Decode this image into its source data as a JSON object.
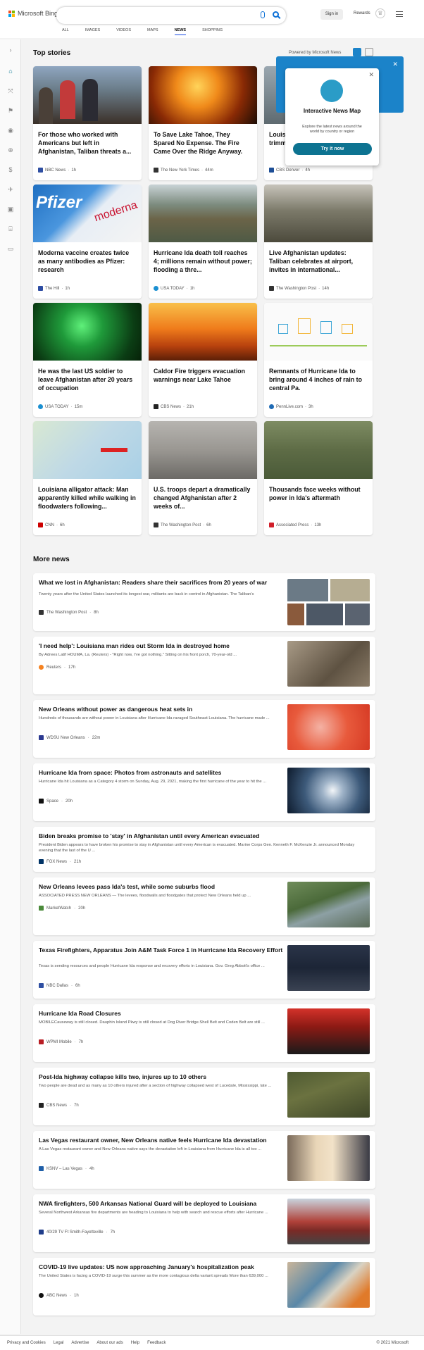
{
  "header": {
    "brand": "Microsoft Bing",
    "signin": "Sign in",
    "rewards": "Rewards",
    "tabs": [
      "ALL",
      "IMAGES",
      "VIDEOS",
      "MAPS",
      "NEWS",
      "SHOPPING"
    ],
    "active_tab": "NEWS"
  },
  "top_stories": {
    "heading": "Top stories",
    "powered_by": "Powered by Microsoft News",
    "cards": [
      {
        "title": "For those who worked with Americans but left in Afghanistan, Taliban threats a...",
        "source": "NBC News",
        "time": "1h",
        "source_color": "#2f4fa2"
      },
      {
        "title": "To Save Lake Tahoe, They Spared No Expense. The Fire Came Over the Ridge Anyway.",
        "source": "The New York Times",
        "time": "44m",
        "source_color": "#333333"
      },
      {
        "title": "Louisiana power grid, tree trimming, Grate... Red C...",
        "source": "CBS Denver",
        "time": "4h",
        "source_color": "#1d4e96"
      },
      {
        "title": "Moderna vaccine creates twice as many antibodies as Pfizer: research",
        "source": "The Hill",
        "time": "1h",
        "source_color": "#2d4ca2"
      },
      {
        "title": "Hurricane Ida death toll reaches 4; millions remain without power; flooding a thre...",
        "source": "USA TODAY",
        "time": "1h",
        "source_color": "#1a8fd1"
      },
      {
        "title": "Live Afghanistan updates: Taliban celebrates at airport, invites in international...",
        "source": "The Washington Post",
        "time": "14h",
        "source_color": "#333333"
      },
      {
        "title": "He was the last US soldier to leave Afghanistan after 20 years of occupation",
        "source": "USA TODAY",
        "time": "15m",
        "source_color": "#1a8fd1"
      },
      {
        "title": "Caldor Fire triggers evacuation warnings near Lake Tahoe",
        "source": "CBS News",
        "time": "21h",
        "source_color": "#222222"
      },
      {
        "title": "Remnants of Hurricane Ida to bring around 4 inches of rain to central Pa.",
        "source": "PennLive.com",
        "time": "3h",
        "source_color": "#1f6bb5"
      },
      {
        "title": "Louisiana alligator attack: Man apparently killed while walking in floodwaters following...",
        "source": "CNN",
        "time": "6h",
        "source_color": "#cc0000"
      },
      {
        "title": "U.S. troops depart a dramatically changed Afghanistan after 2 weeks of...",
        "source": "The Washington Post",
        "time": "6h",
        "source_color": "#333333"
      },
      {
        "title": "Thousands face weeks without power in Ida's aftermath",
        "source": "Associated Press",
        "time": "13h",
        "source_color": "#d11f2a"
      }
    ]
  },
  "promo": {
    "title": "Interactive News Map",
    "description": "Explore the latest news around the world by country or region",
    "button": "Try it now"
  },
  "more_news": {
    "heading": "More news",
    "items": [
      {
        "title": "What we lost in Afghanistan: Readers share their sacrifices from 20 years of war",
        "snippet": "Twenty years after the United States launched its longest war, militants are back in control in Afghanistan. The Taliban's",
        "source": "The Washington Post",
        "time": "8h",
        "source_color": "#333333"
      },
      {
        "title": "'I need help': Louisiana man rides out Storm Ida in destroyed home",
        "snippet": "By Adrees Latif HOUMA, La. (Reuters) - \"Right now, I've got nothing.\" Sitting on his front porch, 70-year-old ...",
        "source": "Reuters",
        "time": "17h",
        "source_color": "#f58220"
      },
      {
        "title": "New Orleans without power as dangerous heat sets in",
        "snippet": "Hundreds of thousands are without power in Louisiana after Hurricane Ida ravaged Southeast Louisiana. The hurricane made ...",
        "source": "WDSU New Orleans",
        "time": "22m",
        "source_color": "#2b3990"
      },
      {
        "title": "Hurricane Ida from space: Photos from astronauts and satellites",
        "snippet": "Hurricane Ida hit Louisiana as a Category 4 storm on Sunday, Aug. 29, 2021, making the first hurricane of the year to hit the ...",
        "source": "Space",
        "time": "20h",
        "source_color": "#111111"
      },
      {
        "title": "Biden breaks promise to 'stay' in Afghanistan until every American evacuated",
        "snippet": "President Biden appears to have broken his promise to stay in Afghanistan until every American is evacuated. Marine Corps Gen. Kenneth F. McKenzie Jr. announced Monday evening that the last of the U ...",
        "source": "FOX News",
        "time": "21h",
        "source_color": "#003366"
      },
      {
        "title": "New Orleans levees pass Ida's test, while some suburbs flood",
        "snippet": "ASSOCIATED PRESS NEW ORLEANS — The levees, floodwalls and floodgates that protect New Orleans held up ...",
        "source": "MarketWatch",
        "time": "20h",
        "source_color": "#4a8a3a"
      },
      {
        "title": "Texas Firefighters, Apparatus Join A&M Task Force 1 in Hurricane Ida Recovery Effort",
        "snippet": "Texas is sending resources and people Hurricane Ida response and recovery efforts in Louisiana. Gov. Greg Abbott's office ...",
        "source": "NBC Dallas",
        "time": "6h",
        "source_color": "#2f4fa2"
      },
      {
        "title": "Hurricane Ida Road Closures",
        "snippet": "MOBILECauseway is still closed. Dauphin Island Pkwy is still closed at Dog River Bridge.Shell Belt and Coden Belt are still ...",
        "source": "WPMI Mobile",
        "time": "7h",
        "source_color": "#b81d24"
      },
      {
        "title": "Post-Ida highway collapse kills two, injures up to 10 others",
        "snippet": "Two people are dead and as many as 10 others injured after a section of highway collapsed west of Lucedale, Mississippi, late ...",
        "source": "CBS News",
        "time": "7h",
        "source_color": "#222222"
      },
      {
        "title": "Las Vegas restaurant owner, New Orleans native feels Hurricane Ida devastation",
        "snippet": "A Las Vegas restaurant owner and New Orleans native says the devastation left in Louisiana from Hurricane Ida is all too ...",
        "source": "KSNV – Las Vegas",
        "time": "4h",
        "source_color": "#1f5fa8"
      },
      {
        "title": "NWA firefighters, 500 Arkansas National Guard will be deployed to Louisiana",
        "snippet": "Several Northwest Arkansas fire departments are heading to Louisiana to help with search and rescue efforts after Hurricane ...",
        "source": "40/29 TV Ft Smith-Fayetteville",
        "time": "7h",
        "source_color": "#1f3d8a"
      },
      {
        "title": "COVID-19 live updates: US now approaching January's hospitalization peak",
        "snippet": "The United States is facing a COVID-19 surge this summer as the more contagious delta variant spreads More than 639,000 ...",
        "source": "ABC News",
        "time": "1h",
        "source_color": "#111111"
      }
    ]
  },
  "footer": {
    "links": [
      "Privacy and Cookies",
      "Legal",
      "Advertise",
      "About our ads",
      "Help",
      "Feedback"
    ],
    "copyright": "© 2021 Microsoft"
  }
}
